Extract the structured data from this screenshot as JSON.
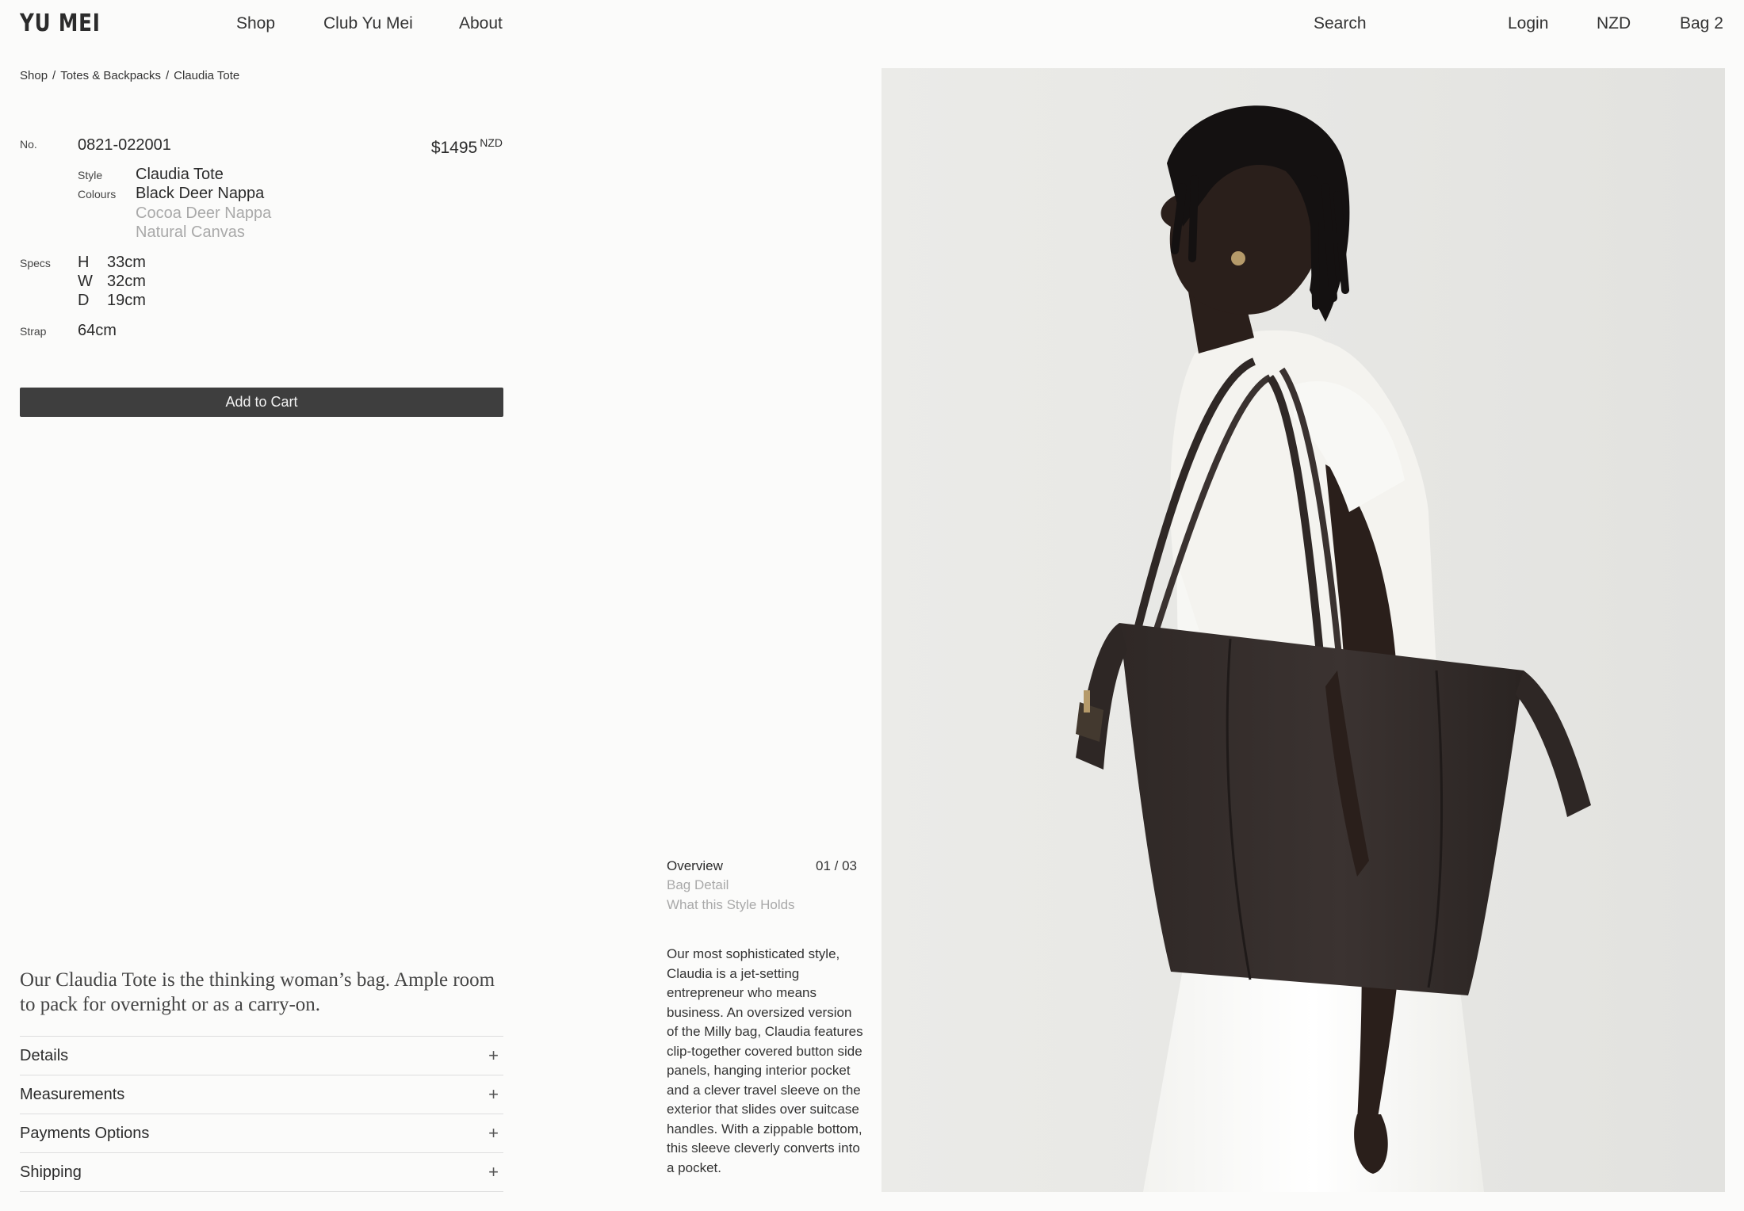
{
  "header": {
    "logo": "YU MEI",
    "nav": [
      "Shop",
      "Club Yu Mei",
      "About"
    ],
    "search": "Search",
    "login": "Login",
    "currency": "NZD",
    "bag": "Bag 2"
  },
  "breadcrumb": [
    "Shop",
    "/",
    "Totes & Backpacks",
    "/",
    "Claudia Tote"
  ],
  "product": {
    "no_label": "No.",
    "no_value": "0821-022001",
    "price": "$1495",
    "price_currency": "NZD",
    "style_label": "Style",
    "style_value": "Claudia Tote",
    "colours_label": "Colours",
    "colours": [
      "Black Deer Nappa",
      "Cocoa Deer Nappa",
      "Natural Canvas"
    ],
    "specs_label": "Specs",
    "specs": [
      {
        "dim": "H",
        "value": "33cm"
      },
      {
        "dim": "W",
        "value": "32cm"
      },
      {
        "dim": "D",
        "value": "19cm"
      }
    ],
    "strap_label": "Strap",
    "strap_value": "64cm",
    "add_to_cart": "Add to Cart"
  },
  "tagline": "Our Claudia Tote is the thinking woman’s bag. Ample room to pack for overnight or as a carry-on.",
  "accordion": [
    "Details",
    "Measurements",
    "Payments Options",
    "Shipping"
  ],
  "accordion_icon": "plus-icon",
  "gallery": {
    "items": [
      "Overview",
      "Bag Detail",
      "What this Style Holds"
    ],
    "counter": "01 / 03"
  },
  "description": "Our most sophisticated style, Claudia is a jet-setting entrepreneur who means business. An oversized version of the Milly bag, Claudia features clip-together covered button side panels, hanging interior pocket and a clever travel sleeve on the exterior that slides over suitcase handles. With a zippable bottom, this sleeve cleverly converts into a pocket.",
  "colors": {
    "background": "#fbfbfa",
    "button": "#3e3e3e",
    "muted_text": "#a9a9a9",
    "bag": "#3a3230"
  }
}
